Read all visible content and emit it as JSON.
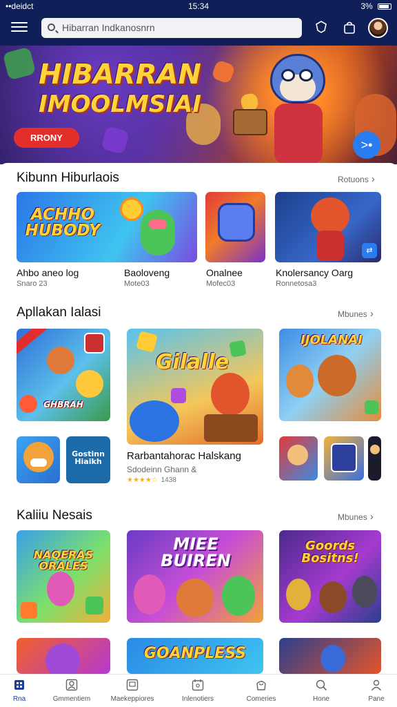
{
  "status_bar": {
    "carrier": "••deidct",
    "time": "15:34",
    "battery": "3%"
  },
  "header": {
    "search_placeholder": "Hibarran Indkanosnrn",
    "icons": [
      "menu-icon",
      "search-icon",
      "shield-icon",
      "bag-icon"
    ]
  },
  "hero": {
    "title_line1": "HIBARRAN",
    "title_line2": "IMOOLMSIAI",
    "button_label": "RRONY",
    "fab_label": ">•"
  },
  "section1": {
    "title": "Kibunn Hiburlaois",
    "more": "Rotuons",
    "items": [
      {
        "art": "ACHHO HUBODY",
        "name": "Ahbo aneo log",
        "sub": "Snaro 23"
      },
      {
        "art": "",
        "name": "Baoloveng",
        "sub": "Mote03"
      },
      {
        "art": "",
        "name": "Onalnee",
        "sub": "Mofec03"
      },
      {
        "art": "",
        "name": "Knolersancy Oarg",
        "sub": "Ronnetosa3"
      }
    ]
  },
  "section2": {
    "title": "Apllakan Ialasi",
    "more": "Mbunes",
    "featured": {
      "art": "Gilalle",
      "name": "Rarbantahorac Halskang",
      "sub": "Sdodeinn Ghann &",
      "rating": "★★★★☆",
      "rating_count": "1438"
    },
    "left_top_art": "GHBRAH",
    "left_bottom_art": "Gostinn Hiaikh",
    "right_top_art": "IJOLANAI"
  },
  "section3": {
    "title": "Kaliiu Nesais",
    "more": "Mbunes",
    "cards": [
      "NAQERAS ORALES",
      "MIEE BUIREN",
      "Goords Bositns!",
      "",
      "GOANPLESS",
      ""
    ]
  },
  "tabbar": {
    "tabs": [
      {
        "label": "Rna",
        "icon": "home-icon"
      },
      {
        "label": "Gmmentiem",
        "icon": "user-icon"
      },
      {
        "label": "Maekeppiores",
        "icon": "store-icon"
      },
      {
        "label": "Inlenotiers",
        "icon": "calendar-icon"
      },
      {
        "label": "Comeries",
        "icon": "bag-icon"
      },
      {
        "label": "Hone",
        "icon": "search-icon"
      },
      {
        "label": "Pane",
        "icon": "profile-icon"
      }
    ]
  },
  "colors": {
    "header_bg": "#0f1f57",
    "accent": "#1d3d9c",
    "cta": "#e32f2a",
    "fab": "#2a7df0"
  }
}
